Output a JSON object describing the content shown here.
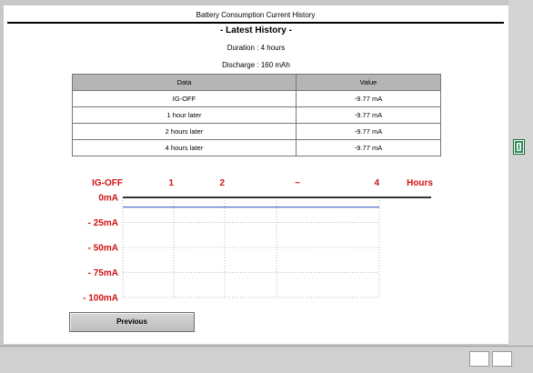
{
  "window": {
    "title": "Battery Consumption Current History",
    "heading": "- Latest History -",
    "duration": "Duration : 4 hours",
    "discharge": "Discharge : 160 mAh"
  },
  "table": {
    "headers": [
      "Data",
      "Value"
    ],
    "rows": [
      {
        "data": "IG-OFF",
        "value": "-9.77 mA"
      },
      {
        "data": "1 hour later",
        "value": "-9.77 mA"
      },
      {
        "data": "2 hours later",
        "value": "-9.77 mA"
      },
      {
        "data": "4 hours later",
        "value": "-9.77 mA"
      }
    ]
  },
  "chart_data": {
    "type": "line",
    "x_tick_labels": [
      "IG-OFF",
      "1",
      "2",
      "~",
      "4"
    ],
    "x_unit_label": "Hours",
    "y_tick_labels": [
      "0mA",
      "- 25mA",
      "- 50mA",
      "- 75mA",
      "- 100mA"
    ],
    "ylim": [
      -100,
      0
    ],
    "series": [
      {
        "x": [
          0,
          1,
          2,
          3,
          4
        ],
        "values": [
          -9.77,
          -9.77,
          -9.77,
          -9.77,
          -9.77
        ]
      }
    ],
    "grid": true,
    "label_color": "#d01010",
    "line_color": "#3b5bbd"
  },
  "buttons": {
    "previous": "Previous"
  },
  "icons": {
    "exit": "exit-door-icon"
  }
}
